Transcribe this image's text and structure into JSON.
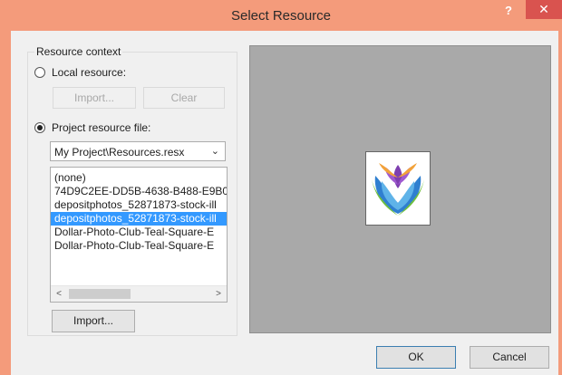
{
  "window": {
    "title": "Select Resource",
    "help_glyph": "?",
    "close_glyph": "✕"
  },
  "context": {
    "legend": "Resource context",
    "local_label": "Local resource:",
    "import_disabled_label": "Import...",
    "clear_label": "Clear",
    "project_label": "Project resource file:",
    "local_selected": false,
    "project_selected": true
  },
  "resource_file": {
    "selected": "My Project\\Resources.resx",
    "arrow": "⌄"
  },
  "resources": {
    "items": [
      "(none)",
      "74D9C2EE-DD5B-4638-B488-E9B0",
      "depositphotos_52871873-stock-ill",
      "depositphotos_52871873-stock-ill",
      "Dollar-Photo-Club-Teal-Square-E",
      "Dollar-Photo-Club-Teal-Square-E"
    ],
    "selected_index": 3,
    "scroll_left": "<",
    "scroll_right": ">"
  },
  "import_button_label": "Import...",
  "footer": {
    "ok_label": "OK",
    "cancel_label": "Cancel"
  },
  "colors": {
    "titlebar": "#f49b7b",
    "close_button": "#d9534f",
    "selection": "#3399ff",
    "preview_bg": "#a9a9a9"
  },
  "preview_image": "lotus-hands-logo"
}
